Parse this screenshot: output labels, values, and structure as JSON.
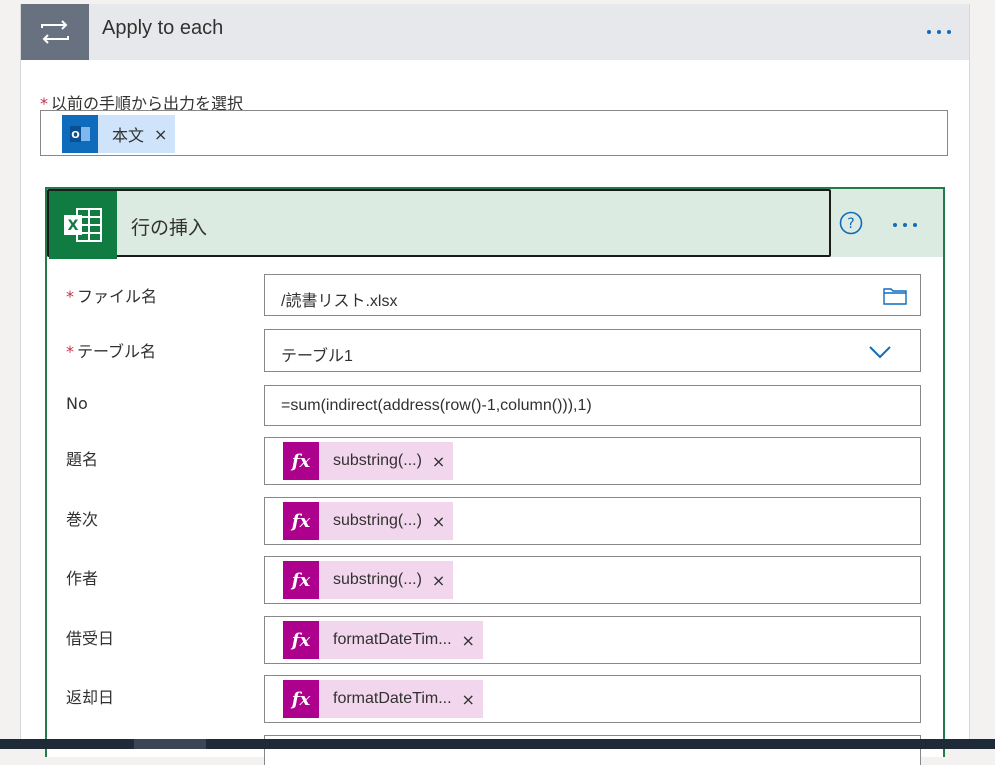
{
  "loop": {
    "title": "Apply to each",
    "icon": "loop-icon",
    "select_label": "以前の手順から出力を選択",
    "token": {
      "icon": "outlook-icon",
      "label": "本文",
      "remove": "×"
    }
  },
  "action": {
    "title": "行の挿入",
    "icon": "excel-icon",
    "help": "?",
    "fields": {
      "file": {
        "label": "ファイル名",
        "value": "/読書リスト.xlsx",
        "icon": "folder-icon"
      },
      "table": {
        "label": "テーブル名",
        "value": "テーブル1",
        "icon": "chevron-down-icon"
      },
      "no": {
        "label": "No",
        "value": "=sum(indirect(address(row()-1,column())),1)"
      },
      "title": {
        "label": "題名",
        "token": "substring(...)"
      },
      "volume": {
        "label": "巻次",
        "token": "substring(...)"
      },
      "author": {
        "label": "作者",
        "token": "substring(...)"
      },
      "borrow_date": {
        "label": "借受日",
        "token": "formatDateTim..."
      },
      "return_date": {
        "label": "返却日",
        "token": "formatDateTim..."
      }
    },
    "fx_symbol": "fx",
    "remove": "×"
  },
  "colors": {
    "excel": "#107c41",
    "expression": "#ad008c",
    "outlook": "#0f6cbd",
    "required": "#c4314b"
  }
}
